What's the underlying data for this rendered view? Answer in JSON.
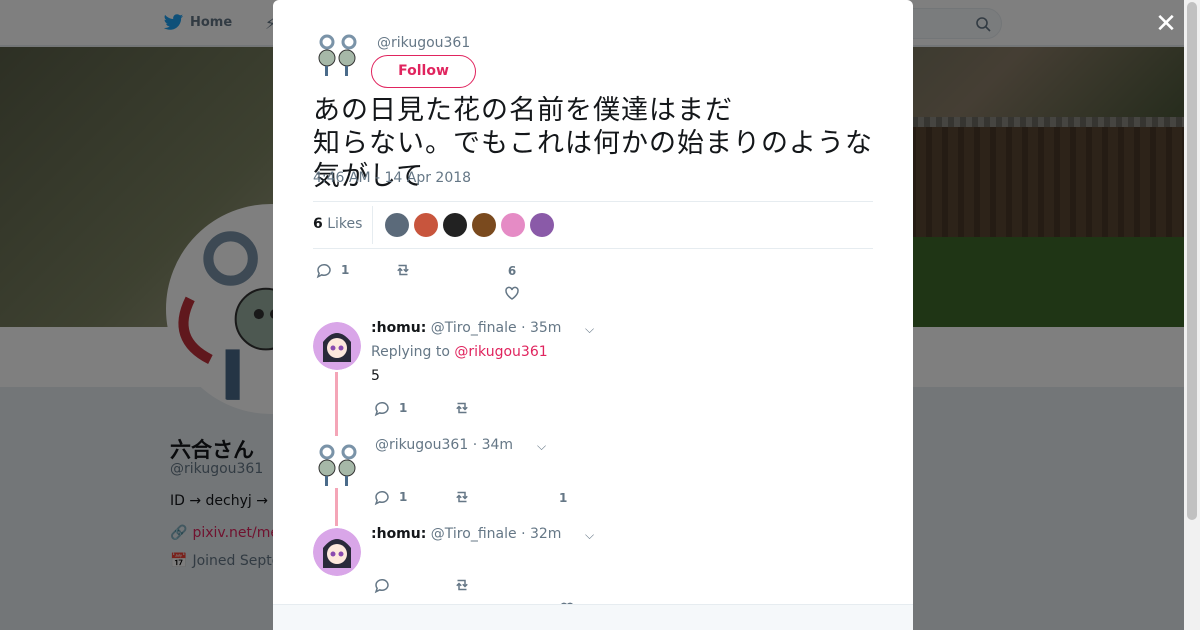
{
  "nav": {
    "home_label": "Home"
  },
  "profile": {
    "name": "六合さん",
    "handle": "@rikugou361",
    "bio": "ID → dechyj  →",
    "link": "pixiv.net/me",
    "joined": "Joined Septe"
  },
  "tweet": {
    "handle": "@rikugou361",
    "follow_label": "Follow",
    "text_line1": "あの日見た花の名前を僕達はまだ",
    "text_line2": "知らない。でもこれは何かの始まりのような気がして",
    "timestamp": "4:46 AM - 14 Apr 2018",
    "likes_count": "6",
    "likes_label": "Likes",
    "reply_count": "1",
    "like_count": "6"
  },
  "likers": [
    {
      "color": "#5b6a7a"
    },
    {
      "color": "#c8553d"
    },
    {
      "color": "#222222"
    },
    {
      "color": "#7a4a1e"
    },
    {
      "color": "#e58bc5"
    },
    {
      "color": "#8a5aa8"
    }
  ],
  "replies": [
    {
      "name": ":homu:",
      "handle": "@Tiro_finale",
      "time": "· 35m",
      "replying_prefix": "Replying to",
      "replying_to": "@rikugou361",
      "text": "5",
      "reply_count": "1",
      "like_count": ""
    },
    {
      "name": "",
      "handle": "@rikugou361",
      "time": "· 34m",
      "reply_count": "1",
      "like_count": "1"
    },
    {
      "name": ":homu:",
      "handle": "@Tiro_finale",
      "time": "· 32m",
      "reply_count": "",
      "like_count": ""
    }
  ],
  "colors": {
    "accent": "#e0245e",
    "thread": "#f4a5b7",
    "muted": "#657786"
  }
}
